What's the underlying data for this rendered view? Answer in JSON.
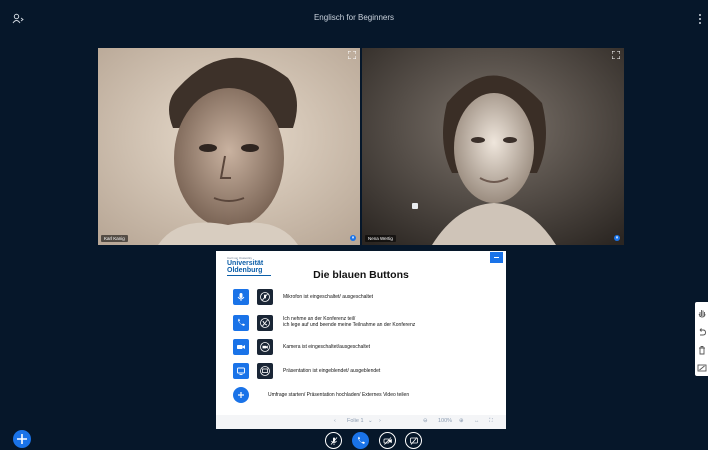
{
  "meeting": {
    "title": "Englisch for Beginners"
  },
  "videos": [
    {
      "name": "Karl Kanig"
    },
    {
      "name": "Nena Wertig"
    }
  ],
  "presentation": {
    "logo": {
      "small": "Carl von Ossietzky",
      "line1": "Universität",
      "line2": "Oldenburg"
    },
    "slide_title": "Die blauen Buttons",
    "rows": [
      {
        "icon": "microphone-icon",
        "text": "Mikrofon ist eingeschaltet/ ausgeschaltet"
      },
      {
        "icon": "phone-icon",
        "text": "Ich nehme an der Konferenz teil/",
        "text2": "ich lege auf und beende meine Teilnahme an der Konferenz"
      },
      {
        "icon": "camera-icon",
        "text": "Kamera ist eingeschaltet/ausgeschaltet"
      },
      {
        "icon": "screen-share-icon",
        "text": "Präsentation ist eingeblendet/  ausgeblendet"
      },
      {
        "icon": "plus-icon",
        "text": "Umfrage starten/ Präsentation hochladen/ Externes Video teilen"
      }
    ],
    "toolbar": {
      "prev": "‹",
      "slide_label": "Folie 1",
      "next": "›",
      "zoom": "100%"
    }
  },
  "colors": {
    "background": "#06172a",
    "accent": "#1a73e8",
    "icon_dark": "#1a2636"
  }
}
